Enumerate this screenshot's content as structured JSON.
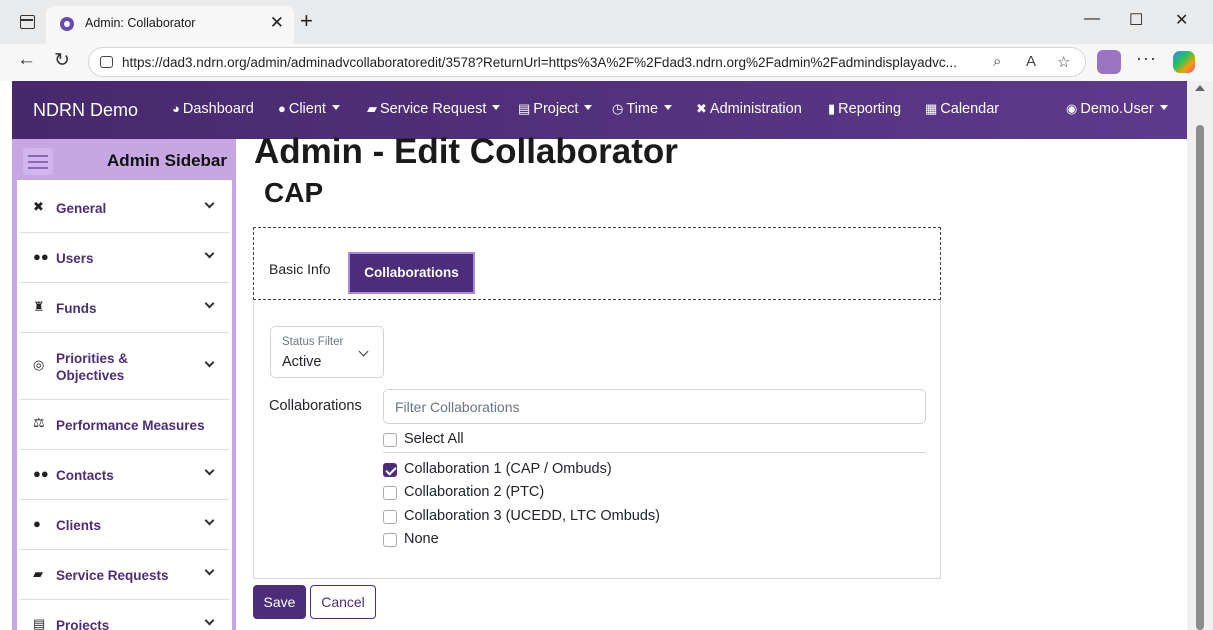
{
  "browser": {
    "tab_title": "Admin: Collaborator",
    "url": "https://dad3.ndrn.org/admin/adminadvcollaboratoredit/3578?ReturnUrl=https%3A%2F%2Fdad3.ndrn.org%2Fadmin%2Fadmindisplayadvc..."
  },
  "navbar": {
    "brand": "NDRN Demo",
    "items": [
      {
        "label": "Dashboard",
        "icon": "dashboard-icon",
        "caret": false
      },
      {
        "label": "Client",
        "icon": "user-icon",
        "caret": true
      },
      {
        "label": "Service Request",
        "icon": "briefcase-icon",
        "caret": true
      },
      {
        "label": "Project",
        "icon": "clipboard-icon",
        "caret": true
      },
      {
        "label": "Time",
        "icon": "clock-icon",
        "caret": true
      },
      {
        "label": "Administration",
        "icon": "tools-icon",
        "caret": false
      },
      {
        "label": "Reporting",
        "icon": "file-icon",
        "caret": false
      },
      {
        "label": "Calendar",
        "icon": "calendar-icon",
        "caret": false
      }
    ],
    "user": "Demo.User"
  },
  "sidebar": {
    "title": "Admin Sidebar",
    "items": [
      {
        "label": "General",
        "icon": "tools-icon"
      },
      {
        "label": "Users",
        "icon": "users-icon"
      },
      {
        "label": "Funds",
        "icon": "money-bag-icon"
      },
      {
        "label": "Priorities & Objectives",
        "icon": "target-icon"
      },
      {
        "label": "Performance Measures",
        "icon": "balance-scale-icon"
      },
      {
        "label": "Contacts",
        "icon": "contacts-icon"
      },
      {
        "label": "Clients",
        "icon": "user-icon"
      },
      {
        "label": "Service Requests",
        "icon": "briefcase-icon"
      },
      {
        "label": "Projects",
        "icon": "clipboard-icon"
      }
    ]
  },
  "main": {
    "title": "Admin - Edit Collaborator",
    "subtitle": "CAP",
    "tabs": [
      "Basic Info",
      "Collaborations"
    ],
    "status_filter": {
      "label": "Status Filter",
      "value": "Active"
    },
    "collaborations_label": "Collaborations",
    "filter_placeholder": "Filter Collaborations",
    "select_all": "Select All",
    "options": [
      {
        "label": "Collaboration 1 (CAP / Ombuds)",
        "checked": true
      },
      {
        "label": "Collaboration 2 (PTC)",
        "checked": false
      },
      {
        "label": "Collaboration 3 (UCEDD, LTC Ombuds)",
        "checked": false
      },
      {
        "label": "None",
        "checked": false
      }
    ],
    "save": "Save",
    "cancel": "Cancel"
  },
  "colors": {
    "primary": "#4d2d7a",
    "navbar": "#5e3a8c",
    "sidebar": "#c6a7e3"
  }
}
